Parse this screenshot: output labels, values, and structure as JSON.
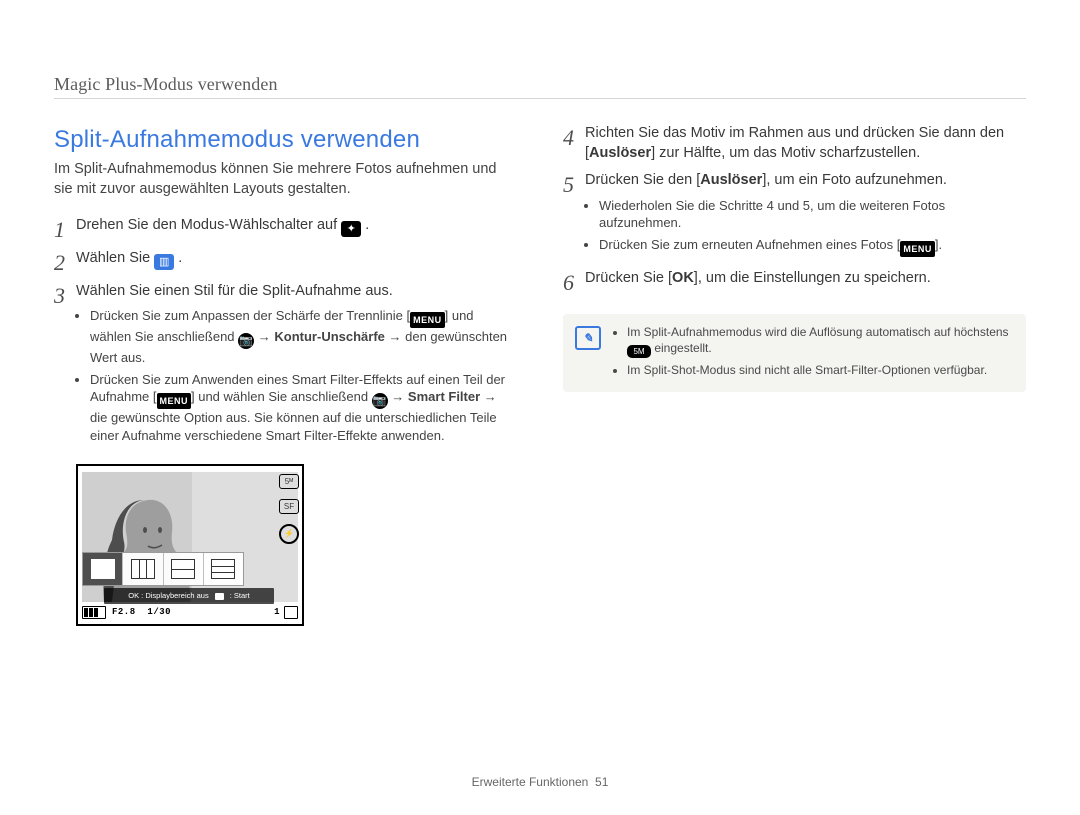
{
  "breadcrumb": "Magic Plus-Modus verwenden",
  "footer_section": "Erweiterte Funktionen",
  "footer_page": "51",
  "left": {
    "title": "Split-Aufnahmemodus verwenden",
    "intro": "Im Split-Aufnahmemodus können Sie mehrere Fotos aufnehmen und sie mit zuvor ausgewählten Layouts gestalten.",
    "step1_pre": "Drehen Sie den Modus-Wählschalter auf ",
    "step1_post": ".",
    "step2_pre": "Wählen Sie ",
    "step2_post": ".",
    "step3": "Wählen Sie einen Stil für die Split-Aufnahme aus.",
    "b1_a": "Drücken Sie zum Anpassen der Schärfe der Trennlinie [",
    "b1_b": "] und wählen Sie anschließend ",
    "b1_arrow": " → ",
    "b1_c": "Kontur-Unschärfe",
    "b1_d": " → den gewünschten Wert aus.",
    "b2_a": "Drücken Sie zum Anwenden eines Smart Filter-Effekts auf einen Teil der Aufnahme [",
    "b2_b": "] und wählen Sie anschließend ",
    "b2_arrow": " → ",
    "b2_c": "Smart Filter",
    "b2_d": " → die gewünschte Option aus. Sie können auf die unterschiedlichen Teile einer Aufnahme verschiedene Smart Filter-Effekte anwenden."
  },
  "right": {
    "s4_a": "Richten Sie das Motiv im Rahmen aus und drücken Sie dann den [",
    "s4_b": "Auslöser",
    "s4_c": "] zur Hälfte, um das Motiv scharfzustellen.",
    "s5_a": "Drücken Sie den [",
    "s5_b": "Auslöser",
    "s5_c": "], um ein Foto aufzunehmen.",
    "s5_bul1": "Wiederholen Sie die Schritte 4 und 5, um die weiteren Fotos aufzunehmen.",
    "s5_bul2_a": "Drücken Sie zum erneuten Aufnehmen eines Fotos [",
    "s5_bul2_b": "].",
    "s6_a": "Drücken Sie [",
    "s6_b": "], um die Einstellungen zu speichern.",
    "note_l1_a": "Im Split-Aufnahmemodus wird die Auflösung automatisch auf höchstens ",
    "note_l1_b": " eingestellt.",
    "note_l2": "Im Split-Shot-Modus sind nicht alle Smart-Filter-Optionen verfügbar."
  },
  "icons": {
    "mode_dial_star": "✦",
    "split_tile": "▥",
    "menu_label": "MENU",
    "camera": "📷",
    "ok_label": "OK",
    "res_label": "5M"
  },
  "shot": {
    "hint_left": "OK : Displaybereich aus",
    "hint_right": ": Start",
    "fnumber": "F2.8",
    "shutter": "1/30",
    "counter": "1"
  }
}
